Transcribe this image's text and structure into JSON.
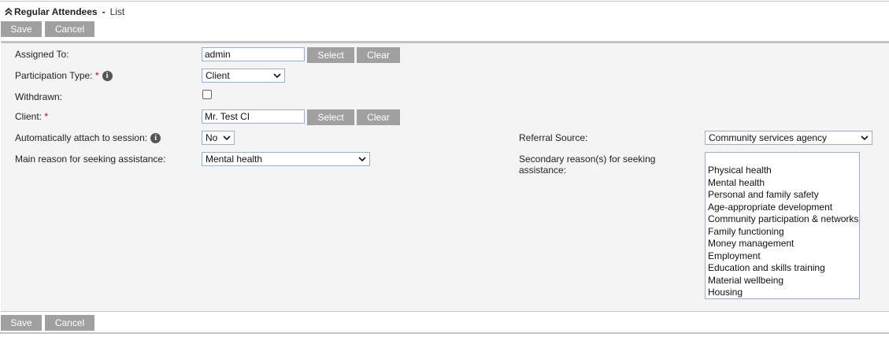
{
  "header": {
    "title": "Regular Attendees",
    "separator": "-",
    "subtitle": "List"
  },
  "actions": {
    "save_label": "Save",
    "cancel_label": "Cancel",
    "select_label": "Select",
    "clear_label": "Clear"
  },
  "form": {
    "assigned_to": {
      "label": "Assigned To:",
      "value": "admin"
    },
    "participation_type": {
      "label": "Participation Type:",
      "required": "*",
      "value": "Client"
    },
    "withdrawn": {
      "label": "Withdrawn:",
      "checked": false
    },
    "client": {
      "label": "Client:",
      "required": "*",
      "value": "Mr. Test CI"
    },
    "auto_attach": {
      "label": "Automatically attach to session:",
      "value": "No"
    },
    "main_reason": {
      "label": "Main reason for seeking assistance:",
      "value": "Mental health"
    },
    "referral_source": {
      "label": "Referral Source:",
      "value": "Community services agency"
    },
    "secondary_reasons": {
      "label": "Secondary reason(s) for seeking assistance:",
      "options": [
        "Physical health",
        "Mental health",
        "Personal and family safety",
        "Age-appropriate development",
        "Community participation & networks",
        "Family functioning",
        "Money management",
        "Employment",
        "Education and skills training",
        "Material wellbeing",
        "Housing"
      ]
    }
  },
  "icons": {
    "info": "info-icon",
    "collapse": "chevron-double-up-icon",
    "dropdown": "chevron-down-icon"
  },
  "colors": {
    "button_bg": "#a0a0a0",
    "input_border": "#8fb3d6",
    "required": "#cc0000",
    "panel_bg": "#f4f4f4"
  }
}
